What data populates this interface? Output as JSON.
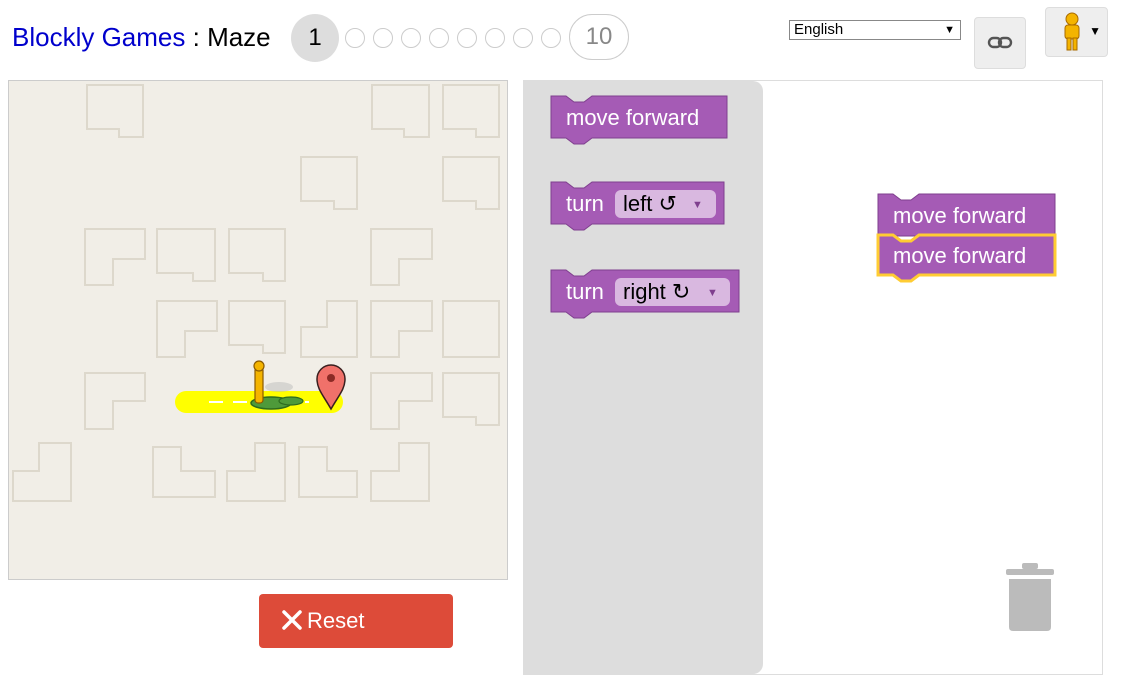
{
  "header": {
    "app_title": "Blockly Games",
    "separator": " : ",
    "game_title": "Maze",
    "levels": {
      "current": "1",
      "last": "10",
      "total": 10
    },
    "language": "English"
  },
  "icons": {
    "link": "link-icon",
    "pegman": "pegman-icon",
    "reset": "close-icon",
    "trash": "trash-icon",
    "start": "pegman-avatar",
    "finish": "marker-icon"
  },
  "toolbox": {
    "move_forward": "move forward",
    "turn_label": "turn",
    "left_option": "left ↺",
    "right_option": "right ↻"
  },
  "workspace": {
    "blocks": [
      "move forward",
      "move forward"
    ]
  },
  "controls": {
    "reset_label": "Reset"
  },
  "colors": {
    "block": "#a55bb5",
    "selected_outline": "#fc3",
    "reset": "#dd4b39",
    "path": "#ffff00",
    "link": "#0000cc"
  }
}
